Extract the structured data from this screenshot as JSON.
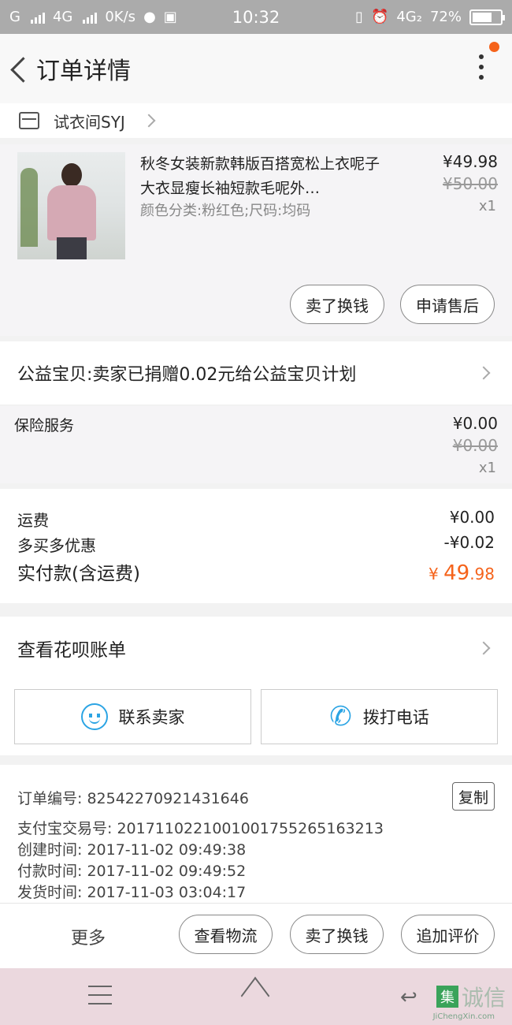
{
  "status": {
    "left_text": "G",
    "net": "4G",
    "speed": "0K/s",
    "time": "10:32",
    "net2": "4G₂",
    "battery": "72%",
    "battery_level": 0.72
  },
  "header": {
    "title": "订单详情"
  },
  "shop": {
    "name": "试衣间SYJ"
  },
  "item": {
    "title": "秋冬女装新款韩版百搭宽松上衣呢子大衣显瘦长袖短款毛呢外…",
    "spec": "颜色分类:粉红色;尺码:均码",
    "price": "¥49.98",
    "price_old": "¥50.00",
    "qty": "x1",
    "btn_sell": "卖了换钱",
    "btn_aftersale": "申请售后"
  },
  "charity": {
    "text": "公益宝贝:卖家已捐赠0.02元给公益宝贝计划"
  },
  "insurance": {
    "label": "保险服务",
    "price": "¥0.00",
    "price_old": "¥0.00",
    "qty": "x1"
  },
  "summary": {
    "freight_label": "运费",
    "freight": "¥0.00",
    "discount_label": "多买多优惠",
    "discount": "-¥0.02",
    "total_label": "实付款(含运费)",
    "total_symbol": "¥",
    "total_int": "49",
    "total_dec": ".98"
  },
  "huabei": {
    "text": "查看花呗账单"
  },
  "contact": {
    "seller": "联系卖家",
    "call": "拨打电话"
  },
  "info": {
    "order_no": "订单编号: 82542270921431646",
    "copy": "复制",
    "alipay": "支付宝交易号: 2017110221001001755265163213",
    "created": "创建时间: 2017-11-02  09:49:38",
    "paid": "付款时间: 2017-11-02  09:49:52",
    "shipped": "发货时间: 2017-11-03  03:04:17"
  },
  "actions": {
    "more": "更多",
    "logistics": "查看物流",
    "sell": "卖了换钱",
    "review": "追加评价"
  },
  "watermark": {
    "box": "集",
    "text": "诚信",
    "sub": "JiChengXin.com"
  },
  "colors": {
    "accent": "#f5631b",
    "blue": "#2ba4e4"
  }
}
